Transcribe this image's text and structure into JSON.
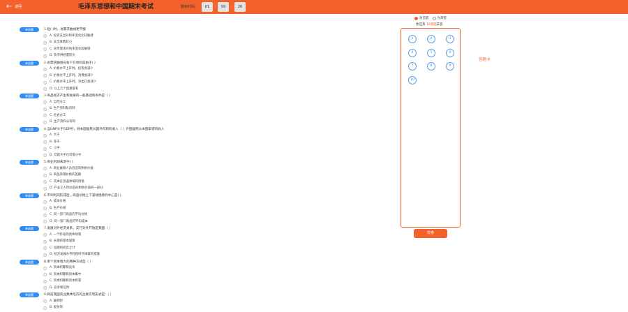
{
  "header": {
    "back_label": "返回",
    "title": "毛泽东思想和中国期末考试",
    "timer_label": "剩余时间:",
    "timer": [
      "01",
      "59",
      "26"
    ],
    "timer_separator": ":"
  },
  "badge_label": "单选题",
  "questions": [
    {
      "stem": "1.短(   )时，总需求曲线更平缓",
      "options": [
        "A. 投资支出对利率变化比较敏感",
        "B. 支出乘数较小",
        "C. 货币需求对利率变化较敏感",
        "D. 货币供给量较大"
      ]
    },
    {
      "stem": "2.总需求曲线向右下方倾斜是由于(   )",
      "options": [
        "A. 价格水平上升时，投资会减少",
        "B. 价格水平上升时，消费会减少",
        "C. 价格水平上升时，净出口会减少",
        "D. 以上几个因素都有"
      ]
    },
    {
      "stem": "3.商品经济产生和发展的一般基础和条件是（    ）",
      "options": [
        "A. 自然分工",
        "B. 生产资料私有制",
        "C. 社会分工",
        "D. 生产资料公有制"
      ]
    },
    {
      "stem": "4.当GNP大于GDP时，则本国居民从国外得到的收入（ ）外国居民从本国取得的收入",
      "options": [
        "A. 大于",
        "B. 等于",
        "C. 小于",
        "D. 可能大于也可能小于"
      ]
    },
    {
      "stem": "5.商业利润来源于(      )",
      "options": [
        "A. 商业雇佣人员创造的剩余价值",
        "B. 商品商销价格的差额",
        "C. 资本在流通领域的增值",
        "D. 产业工人所创造的剩余价值的一部分"
      ]
    },
    {
      "stem": "6.平均利润形成后，商品价格上下波动围绕的中心是(     )",
      "options": [
        "A. 成本价格",
        "B. 生产价格",
        "C. 同一部门商品的平均价格",
        "D. 同一部门商品的平均成本"
      ]
    },
    {
      "stem": "7.发展对外经济关系，实行对外开放是我国（     ）",
      "options": [
        "A. 一个阶段的具体政策",
        "B. 长期的基本国策",
        "C. 短期的权宜之计",
        "D. 经济发展水平较低时所采取的措施"
      ]
    },
    {
      "stem": "8.单个资本增大的两种方式是（    ）",
      "options": [
        "A. 资本积聚和竞争",
        "B. 资本积聚和资本集中",
        "C. 资本积聚和资本积累",
        "D. 竞争和信用"
      ]
    },
    {
      "stem": "9.目前我国农业集体经济的主要实现形式是:（      ）",
      "options": [
        "A. 雇佣制",
        "B. 股份制"
      ]
    }
  ],
  "answer_sheet": {
    "filter_answered": "为已答",
    "filter_unanswered": "为未答",
    "progress_prefix": "你还有",
    "progress_count": "10道题",
    "progress_suffix": "未答",
    "numbers": [
      "1",
      "2",
      "3",
      "4",
      "5",
      "6",
      "7",
      "8",
      "9",
      "10"
    ],
    "label": "答题卡",
    "submit_label": "交卷"
  },
  "colors": {
    "accent": "#f4622c",
    "badge": "#2f8ff0"
  }
}
